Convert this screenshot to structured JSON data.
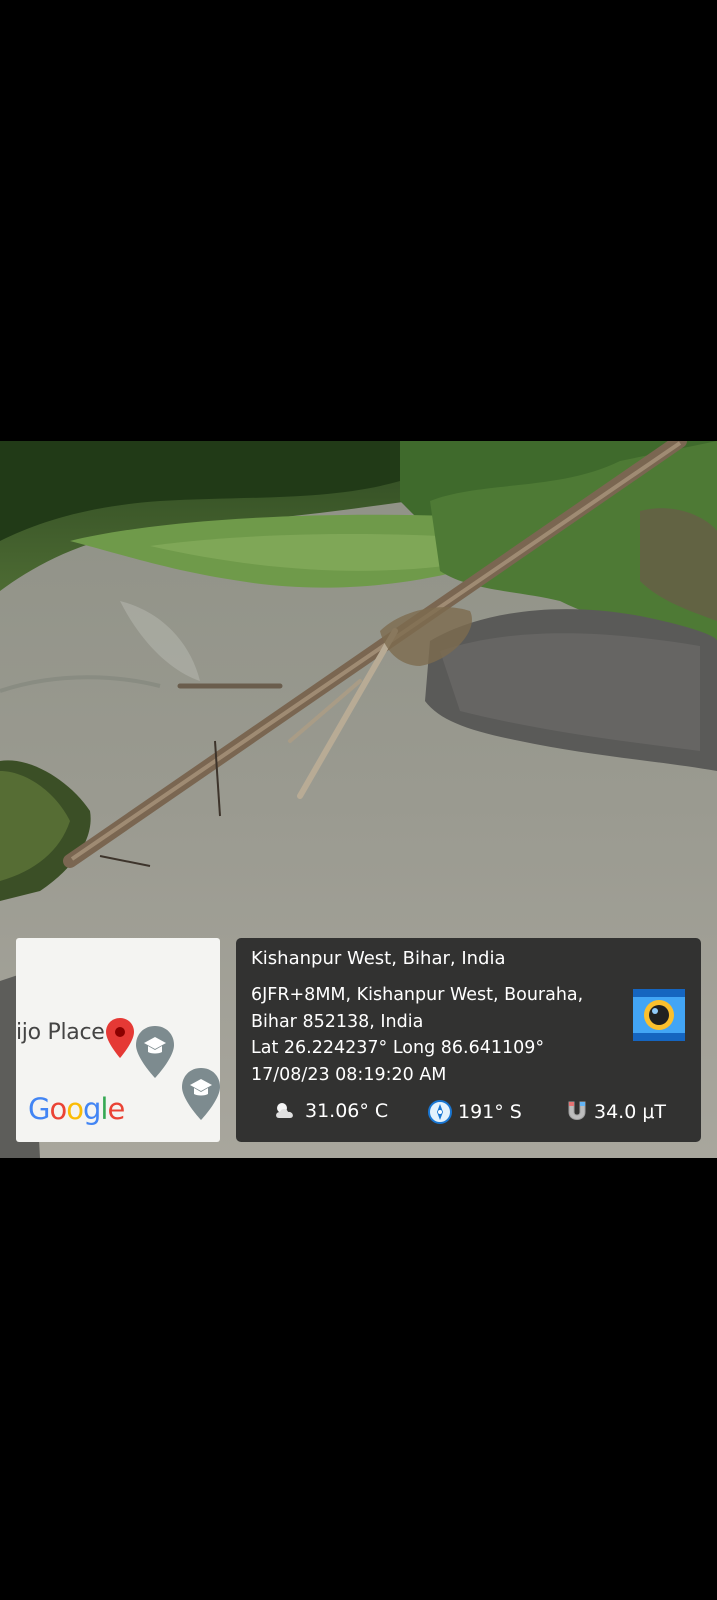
{
  "photo": {
    "description_icon": "river-photo"
  },
  "map": {
    "place_label": "ijo Place",
    "logo": [
      "G",
      "o",
      "o",
      "g",
      "l",
      "e"
    ],
    "logo_colors": [
      "#4285F4",
      "#EA4335",
      "#FBBC05",
      "#4285F4",
      "#34A853",
      "#EA4335"
    ]
  },
  "info": {
    "title": "Kishanpur West, Bihar, India",
    "address_line1": "6JFR+8MM, Kishanpur West, Bouraha,",
    "address_line2": "Bihar 852138, India",
    "coords": "Lat 26.224237° Long 86.641109°",
    "datetime": "17/08/23 08:19:20 AM",
    "temperature": "31.06° C",
    "heading": "191° S",
    "magnetic": "34.0 μT"
  }
}
